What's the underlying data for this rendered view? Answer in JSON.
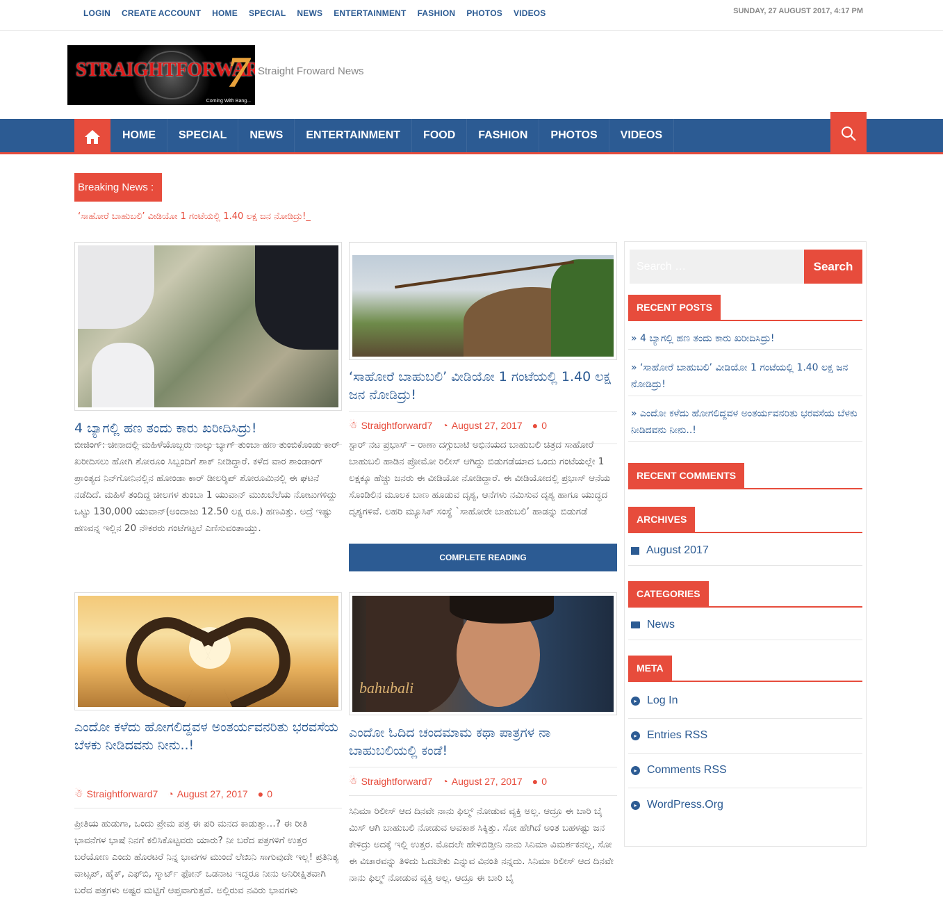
{
  "topbar": {
    "links": [
      "LOGIN",
      "CREATE ACCOUNT",
      "HOME",
      "SPECIAL",
      "NEWS",
      "ENTERTAINMENT",
      "FASHION",
      "PHOTOS",
      "VIDEOS"
    ],
    "date": "SUNDAY, 27 AUGUST 2017, 4:17 PM"
  },
  "header": {
    "logo_text": "STRAIGHTFORWARD",
    "logo_number": "7",
    "logo_tagline": "Coming With Bang...",
    "tagline": "Straight Froward News"
  },
  "nav": {
    "items": [
      "HOME",
      "SPECIAL",
      "NEWS",
      "ENTERTAINMENT",
      "FOOD",
      "FASHION",
      "PHOTOS",
      "VIDEOS"
    ]
  },
  "breaking": {
    "label": "Breaking News :",
    "ticker": "‘ಸಾಹೋರೆ ಬಾಹುಬಲಿ’ ವೀಡಿಯೋ 1 ಗಂಟೆಯಲ್ಲಿ 1.40 ಲಕ್ಷ ಜನ ನೋಡಿದ್ರು!_"
  },
  "posts": [
    {
      "title": "4 ಬ್ಯಾಗಲ್ಲಿ ಹಣ ತಂದು ಕಾರು ಖರೀದಿಸಿದ್ರು!",
      "excerpt": "ಬೀಜಿಂಗ್: ಚೀನಾದಲ್ಲಿ ಮಹಿಳೆಯೊಬ್ಬರು ನಾಲ್ಕು ಬ್ಯಾಗ್ ತುಂಬಾ ಹಣ ತುಂಬಿಕೊಂಡು ಕಾರ್ ಖರೀದಿಸಲು ಹೋಗಿ ಶೋರೂಂ ಸಿಬ್ಬಂದಿಗೆ ಶಾಕ್ ನೀಡಿದ್ದಾರೆ. ಕಳೆದ ವಾರ ಶಾಂಡಾಂಗ್ ಪ್ರಾಂತ್ಯದ ನಿನ್‍ಗೋನಿನಲ್ಲಿನ ಹೋಂಡಾ ಕಾರ್ ಡೀಲರ್‍ಶಿಪ್ ಶೋರೂಮಿನಲ್ಲಿ ಈ ಘಟನೆ ನಡೆದಿದೆ. ಮಹಿಳೆ ತಂದಿದ್ದ ಚೀಲಗಳ ತುಂಬಾ 1 ಯುವಾನ್ ಮುಖಬೆಲೆಯ ನೋಟುಗಳಿದ್ದು ಒಟ್ಟು 130,000 ಯುವಾನ್(ಅಂದಾಜು 12.50 ಲಕ್ಷ ರೂ.) ಹಣವಿತ್ತು. ಅದ್ರೆ ಇಷ್ಟು ಹಣವನ್ನ ಇಲ್ಲಿನ 20 ನೌಕರರು ಗಂಟೆಗಟ್ಟಲೆ ಎಣಿಸುವಂತಾಯ್ತು."
    },
    {
      "title": "‘ಸಾಹೋರೆ ಬಾಹುಬಲಿ’ ವೀಡಿಯೋ 1 ಗಂಟೆಯಲ್ಲಿ 1.40 ಲಕ್ಷ ಜನ ನೋಡಿದ್ರು!",
      "author": "Straightforward7",
      "date": "August 27, 2017",
      "comments": "0",
      "excerpt": "ಸ್ಟಾರ್ ನಟ ಪ್ರಭಾಸ್ – ರಾಣಾ ದಗ್ಗುಬಾಟಿ ಅಭಿನಯದ ಬಾಹುಬಲಿ ಚಿತ್ರದ ಸಾಹೋರೆ ಬಾಹುಬಲಿ ಹಾಡಿನ ಪ್ರೋಮೋ ರಿಲೀಸ್ ಆಗಿದ್ದು ಬಿಡುಗಡೆಯಾದ ಒಂದು ಗಂಟೆಯಲ್ಲೇ 1 ಲಕ್ಷಕ್ಕೂ ಹೆಚ್ಚು ಜನರು ಈ ವೀಡಿಯೋ ನೋಡಿದ್ದಾರೆ. ಈ ವೀಡಿಯೋದಲ್ಲಿ ಪ್ರಭಾಸ್ ಆನೆಯ ಸೊಂಡಿಲಿನ ಮೂಲಕ ಬಾಣ ಹೂಡುವ ದೃಶ್ಯ, ಆನೆಗಳು ನಮಿಸುವ ದೃಶ್ಯ ಹಾಗೂ ಯುದ್ಧದ ದೃಶ್ಯಗಳಿವೆ. ಲಹರಿ ಮ್ಯೂಸಿಕ್ ಸಂಸ್ಥೆ `ಸಾಹೋರೇ ಬಾಹುಬಲಿ’ ಹಾಡನ್ನು ಬಿಡುಗಡೆ",
      "read_more": "COMPLETE READING"
    },
    {
      "title": "ಎಂದೋ ಕಳೆದು ಹೋಗಲಿದ್ದವಳ ಅಂತರ್ಯವನರಿತು ಭರವಸೆಯ ಬೆಳಕು ನೀಡಿದವನು ನೀನು..!",
      "author": "Straightforward7",
      "date": "August 27, 2017",
      "comments": "0",
      "excerpt": "ಪ್ರೀತಿಯ ಹುಡುಗಾ, ಒಂದು ಪ್ರೇಮ ಪತ್ರ ಈ ಪರಿ ಮನದ ಕಾಡುತ್ತಾ…? ಈ ರೀತಿ ಭಾವನೆಗಳ ಭಾಷೆ ನಿನಗೆ ಕಲಿಸಿಕೊಟ್ಟವರು ಯಾರು? ನೀ ಬರೆದ ಪತ್ರಗಳಿಗೆ ಉತ್ತರ ಬರೆಯೋಣ ಎಂದು ಹೊರಟರೆ ನಿನ್ನ ಭಾವಗಳ ಮುಂದೆ ಲೇಖನಿ ಸಾಗುವುದೇ ಇಲ್ಲ! ಪ್ರತಿನಿತ್ಯ ವಾಟ್ಸಪ್, ಹೈಕ್, ಎಫ್‍ಬಿ, ಸ್ಮಾರ್ಟ್ ಫೋನ್ ಒಡನಾಟ ಇದ್ದರೂ ನೀನು ಅನಿರೀಕ್ಷಿತವಾಗಿ ಬರೆವ ಪತ್ರಗಳು ಅಷ್ಟರ ಮಟ್ಟಿಗೆ ಆಪ್ತವಾಗುತ್ತವೆ. ಅಲ್ಲಿರುವ ನವಿರು ಭಾವಗಳು"
    },
    {
      "title": "ಎಂದೋ ಓದಿದ ಚಂದಮಾಮ ಕಥಾ ಪಾತ್ರಗಳ ನಾ ಬಾಹುಬಲಿಯಲ್ಲಿ ಕಂಡೆ!",
      "author": "Straightforward7",
      "date": "August 27, 2017",
      "comments": "0",
      "excerpt": "ಸಿನಿಮಾ ರಿಲೀಸ್ ಆದ ದಿನವೇ ನಾನು ಫಿಲ್ಮ್ ನೋಡುವ ವ್ಯಕ್ತಿ ಅಲ್ಲ. ಆದ್ರೂ ಈ ಬಾರಿ ಬೈ ಮಿಸ್ ಆಗಿ ಬಾಹುಬಲಿ ನೋಡುವ ಅವಕಾಶ ಸಿಕ್ಕಿತ್ತು. ಸೋ ಹೇಗಿದೆ ಅಂತ ಬಹಳಷ್ಟು ಜನ ಕೇಳಿದ್ರು ಅದಕ್ಕೆ ಇಲ್ಲಿ ಉತ್ತರ. ಮೊದಲೇ ಹೇಳಿಬಿಡ್ತೀನಿ ನಾನು ಸಿನಿಮಾ ವಿಮರ್ಶಕನಲ್ಲ, ಸೋ ಈ ವಿಚಾರವನ್ನು ತಿಳಿದು ಓದಬೇಕು ಎನ್ನುವ ವಿನಂತಿ ನನ್ನದು.  ಸಿನಿಮಾ ರಿಲೀಸ್ ಆದ ದಿನವೇ ನಾನು ಫಿಲ್ಮ್ ನೋಡುವ ವ್ಯಕ್ತಿ ಅಲ್ಲ. ಆದ್ರೂ ಈ ಬಾರಿ ಬೈ"
    }
  ],
  "sidebar": {
    "search_placeholder": "Search …",
    "search_button": "Search",
    "recent_posts_title": "RECENT POSTS",
    "recent_posts": [
      "4 ಬ್ಯಾಗಲ್ಲಿ ಹಣ ತಂದು ಕಾರು ಖರೀದಿಸಿದ್ರು!",
      "‘ಸಾಹೋರೆ ಬಾಹುಬಲಿ’ ವೀಡಿಯೋ 1 ಗಂಟೆಯಲ್ಲಿ 1.40 ಲಕ್ಷ ಜನ ನೋಡಿದ್ರು!",
      "ಎಂದೋ ಕಳೆದು ಹೋಗಲಿದ್ದವಳ ಅಂತರ್ಯವನರಿತು ಭರವಸೆಯ ಬೆಳಕು ನೀಡಿದವನು ನೀನು..!"
    ],
    "recent_comments_title": "RECENT COMMENTS",
    "archives_title": "ARCHIVES",
    "archive_item": "August 2017",
    "categories_title": "CATEGORIES",
    "category_item": "News",
    "meta_title": "META",
    "meta_items": [
      "Log In",
      "Entries RSS",
      "Comments RSS",
      "WordPress.Org"
    ]
  },
  "colors": {
    "primary": "#2c5b93",
    "accent": "#e74c3c"
  }
}
